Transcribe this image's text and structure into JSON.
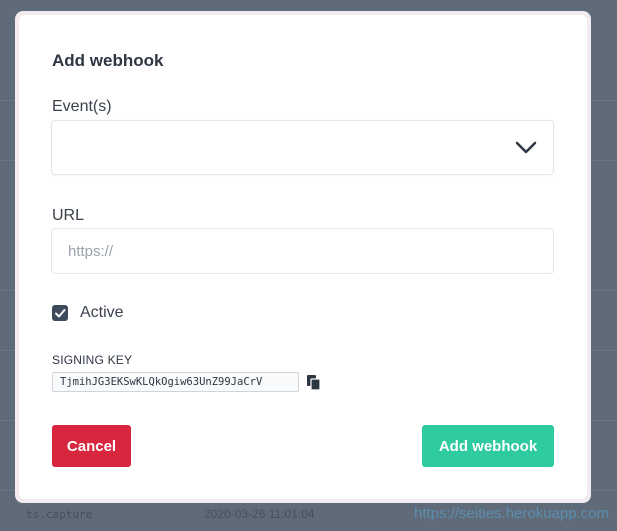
{
  "background": {
    "timestamp": "2020-03-26 11:01:04",
    "event_name": "ts.capture",
    "link": "https://seities.herokuapp.com"
  },
  "modal": {
    "title": "Add webhook",
    "events_label": "Event(s)",
    "events_value": "",
    "url_label": "URL",
    "url_value": "",
    "url_placeholder": "https://",
    "active_label": "Active",
    "active_checked": true,
    "signing_key_label": "SIGNING KEY",
    "signing_key_value": "TjmihJG3EKSwKLQkOgiw63UnZ99JaCrV",
    "cancel_label": "Cancel",
    "submit_label": "Add webhook"
  },
  "icons": {
    "events_dropdown": "chevron-down-icon",
    "copy": "copy-icon",
    "checkbox": "check-icon"
  },
  "colors": {
    "overlay": "#5f6b78",
    "cancel_button": "#d7263d",
    "submit_button": "#2ecaa0",
    "checkbox": "#3d4a5c",
    "title_text": "#2d3643"
  }
}
